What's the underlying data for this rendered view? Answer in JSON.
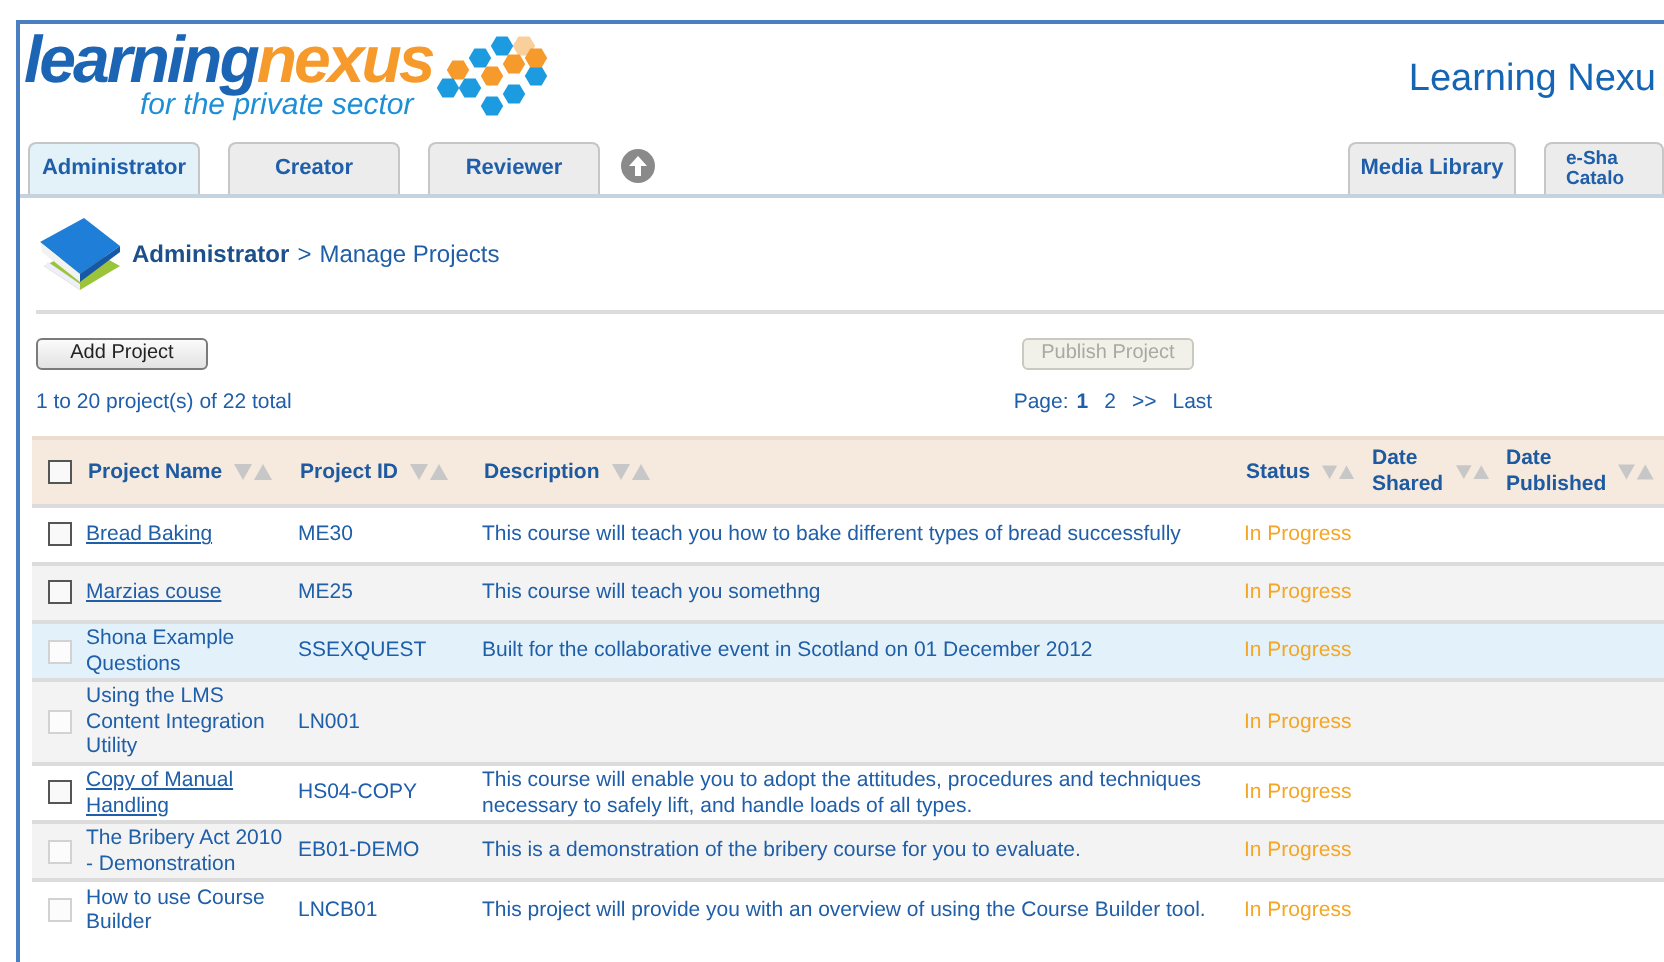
{
  "logo": {
    "part_1": "learning",
    "part_2": "nexus",
    "tagline": "for the private sector"
  },
  "site_title": "Learning Nexu",
  "tabs": [
    {
      "label": "Administrator",
      "selected": true
    },
    {
      "label": "Creator",
      "selected": false
    },
    {
      "label": "Reviewer",
      "selected": false
    }
  ],
  "right_tabs": [
    {
      "lines": [
        "Media Library"
      ],
      "selected": false
    },
    {
      "lines": [
        "e-Sha",
        "Catalo"
      ],
      "selected": false
    }
  ],
  "breadcrumb": {
    "root": "Administrator",
    "separator": ">",
    "current": "Manage Projects"
  },
  "buttons": [
    {
      "label": "Add Project",
      "disabled": false
    },
    {
      "label": "Publish Project",
      "disabled": true
    }
  ],
  "count": "1 to 20 project(s) of 22 total",
  "pagination": {
    "label": "Page:",
    "pages": [
      {
        "label": "1",
        "selected": true
      },
      {
        "label": "2",
        "selected": false
      }
    ],
    "next": ">>",
    "last": "Last"
  },
  "table": {
    "select_all_checked": false,
    "columns": [
      {
        "lines": [
          "Project Name"
        ]
      },
      {
        "lines": [
          "Project ID"
        ]
      },
      {
        "lines": [
          "Description"
        ]
      },
      {
        "lines": [
          "Status"
        ]
      },
      {
        "lines": [
          "Date",
          "Shared"
        ]
      },
      {
        "lines": [
          "Date",
          "Published"
        ]
      }
    ],
    "rows": [
      {
        "name": "Bread Baking",
        "linked": true,
        "checkbox_disabled": false,
        "selected": false,
        "id": "ME30",
        "description": "This course will teach you how to bake different types of bread successfully",
        "status": "In Progress"
      },
      {
        "name": "Marzias couse",
        "linked": true,
        "checkbox_disabled": false,
        "selected": false,
        "id": "ME25",
        "description": "This course will teach you somethng",
        "status": "In Progress"
      },
      {
        "name": "Shona Example Questions",
        "linked": false,
        "checkbox_disabled": true,
        "selected": true,
        "id": "SSEXQUEST",
        "description": "Built for the collaborative event in Scotland on 01 December 2012",
        "status": "In Progress"
      },
      {
        "name": "Using the LMS Content Integration Utility",
        "linked": false,
        "checkbox_disabled": true,
        "selected": false,
        "id": "LN001",
        "description": "",
        "status": "In Progress"
      },
      {
        "name": "Copy of Manual Handling",
        "linked": true,
        "checkbox_disabled": false,
        "selected": false,
        "id": "HS04-COPY",
        "description": "This course will enable you to adopt the attitudes, procedures and techniques necessary to safely lift, and handle loads of all types.",
        "status": "In Progress"
      },
      {
        "name": "The Bribery Act 2010 - Demonstration",
        "linked": false,
        "checkbox_disabled": true,
        "selected": false,
        "id": "EB01-DEMO",
        "description": "This is a demonstration of the bribery course for you to evaluate.",
        "status": "In Progress"
      },
      {
        "name": "How to use Course Builder",
        "linked": false,
        "checkbox_disabled": true,
        "selected": false,
        "id": "LNCB01",
        "description": "This project will provide you with an overview of using the Course Builder tool.",
        "status": "In Progress"
      }
    ]
  }
}
